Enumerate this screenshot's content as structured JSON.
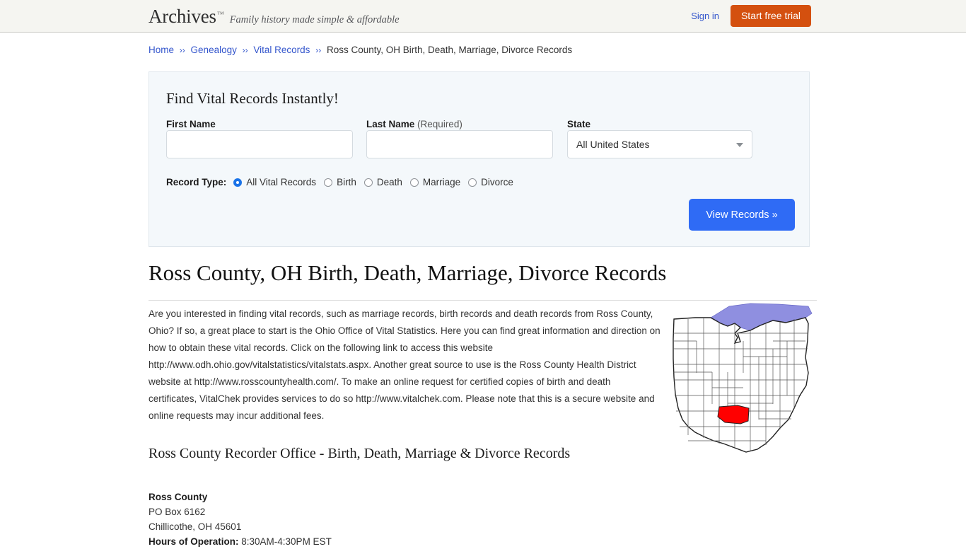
{
  "header": {
    "logo_word": "Archives",
    "logo_tm": "™",
    "tagline": "Family history made simple & affordable",
    "signin_label": "Sign in",
    "trial_label": "Start free trial",
    "brand_orange": "#d4500f",
    "link_blue": "#3355cc",
    "background": "#f5f5f1"
  },
  "breadcrumb": {
    "items": [
      {
        "label": "Home",
        "link": true
      },
      {
        "label": "Genealogy",
        "link": true
      },
      {
        "label": "Vital Records",
        "link": true
      },
      {
        "label": "Ross County, OH Birth, Death, Marriage, Divorce Records",
        "link": false
      }
    ],
    "separator": "››"
  },
  "search_panel": {
    "title": "Find Vital Records Instantly!",
    "first_name_label": "First Name",
    "first_name_value": "",
    "first_name_placeholder": "",
    "last_name_label": "Last Name",
    "last_name_required_note": "(Required)",
    "last_name_value": "",
    "last_name_placeholder": "",
    "state_label": "State",
    "state_value": "All United States",
    "record_type_label": "Record Type:",
    "record_types": [
      {
        "label": "All Vital Records",
        "checked": true
      },
      {
        "label": "Birth",
        "checked": false
      },
      {
        "label": "Death",
        "checked": false
      },
      {
        "label": "Marriage",
        "checked": false
      },
      {
        "label": "Divorce",
        "checked": false
      }
    ],
    "submit_label": "View Records »",
    "submit_color": "#2f6bf5",
    "panel_background": "#f4f8fb"
  },
  "main": {
    "page_title": "Ross County, OH Birth, Death, Marriage, Divorce Records",
    "intro_paragraph": "Are you interested in finding vital records, such as marriage records, birth records and death records from Ross County, Ohio? If so, a great place to start is the Ohio Office of Vital Statistics. Here you can find great information and direction on how to obtain these vital records. Click on the following link to access this website http://www.odh.ohio.gov/vitalstatistics/vitalstats.aspx. Another great source to use is the Ross County Health District website at http://www.rosscountyhealth.com/. To make an online request for certified copies of birth and death certificates, VitalChek provides services to do so http://www.vitalchek.com. Please note that this is a secure website and online requests may incur additional fees.",
    "section_heading": "Ross County Recorder Office - Birth, Death, Marriage & Divorce Records",
    "address": {
      "name": "Ross County",
      "line1": "PO Box 6162",
      "line2": "Chillicothe, OH 45601",
      "hours_label": "Hours of Operation:",
      "hours_value": "8:30AM-4:30PM EST"
    },
    "map": {
      "state": "Ohio",
      "highlighted_county": "Ross County",
      "highlight_color": "#ff0000",
      "water_color": "#8f8fe0",
      "outline_color": "#333333"
    }
  }
}
